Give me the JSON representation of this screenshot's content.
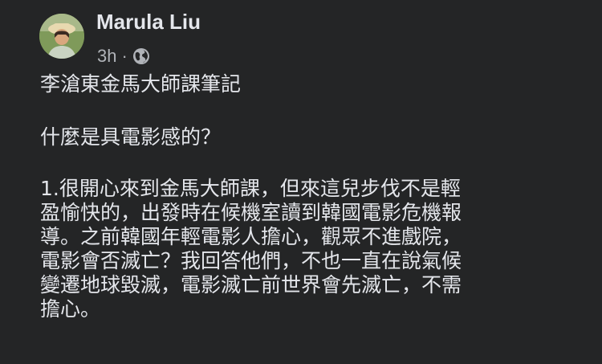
{
  "post": {
    "author": "Marula Liu",
    "time": "3h",
    "separator": "·",
    "privacy_icon": "globe-icon",
    "avatar_icon": "avatar-photo",
    "title": "李滄東金馬大師課筆記",
    "question": "什麼是具電影感的？",
    "paragraph_lines": [
      "1.很開心來到金馬大師課，但來這兒步伐不是輕",
      "盈愉快的，出發時在候機室讀到韓國電影危機報",
      "導。之前韓國年輕電影人擔心，觀眾不進戲院，",
      "電影會否滅亡？我回答他們，不也一直在說氣候",
      "變遷地球毀滅，電影滅亡前世界會先滅亡，不需",
      "擔心。"
    ]
  },
  "colors": {
    "background": "#242526",
    "primary_text": "#e4e6eb",
    "secondary_text": "#b0b3b8"
  }
}
